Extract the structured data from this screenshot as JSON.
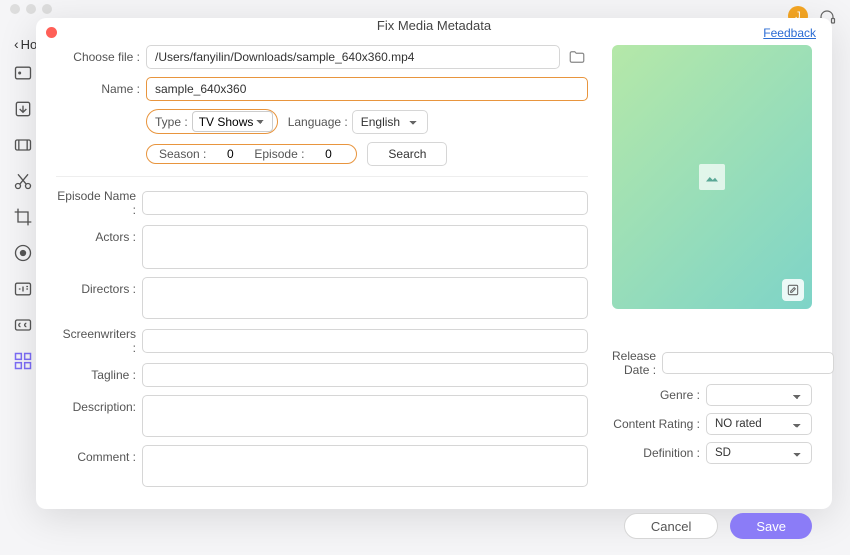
{
  "header": {
    "back_label": "Ho",
    "avatar_initial": "J"
  },
  "modal": {
    "title": "Fix Media Metadata",
    "feedback": "Feedback"
  },
  "form": {
    "choose_file_label": "Choose file :",
    "choose_file_value": "/Users/fanyilin/Downloads/sample_640x360.mp4",
    "name_label": "Name :",
    "name_value": "sample_640x360",
    "type_label": "Type :",
    "type_value": "TV Shows",
    "language_label": "Language :",
    "language_value": "English",
    "season_label": "Season :",
    "season_value": "0",
    "episode_label": "Episode :",
    "episode_value": "0",
    "search_label": "Search",
    "episode_name_label": "Episode Name :",
    "actors_label": "Actors :",
    "directors_label": "Directors :",
    "screenwriters_label": "Screenwriters :",
    "tagline_label": "Tagline :",
    "description_label": "Description:",
    "comment_label": "Comment :"
  },
  "meta": {
    "release_date_label": "Release Date :",
    "genre_label": "Genre :",
    "content_rating_label": "Content Rating :",
    "content_rating_value": "NO rated",
    "definition_label": "Definition :",
    "definition_value": "SD"
  },
  "footer": {
    "cancel": "Cancel",
    "save": "Save"
  }
}
